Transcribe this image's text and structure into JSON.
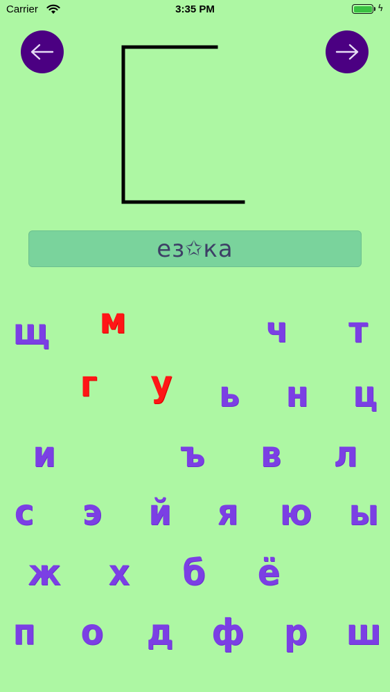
{
  "status_bar": {
    "carrier": "Carrier",
    "time": "3:35 PM"
  },
  "nav": {
    "back_icon": "arrow-left-icon",
    "forward_icon": "arrow-right-icon",
    "button_color": "#4b0082"
  },
  "word": {
    "prefix": "ез",
    "star": "✩",
    "suffix": "ка"
  },
  "colors": {
    "background": "#adf7a3",
    "letter": "#7b3fe4",
    "letter_selected": "#ff1616",
    "word_box": "#7ad39c"
  },
  "letters": [
    {
      "char": "щ",
      "selected": false
    },
    {
      "char": "м",
      "selected": true
    },
    {
      "char": "ч",
      "selected": false
    },
    {
      "char": "т",
      "selected": false
    },
    {
      "char": "г",
      "selected": true
    },
    {
      "char": "у",
      "selected": true
    },
    {
      "char": "ь",
      "selected": false
    },
    {
      "char": "н",
      "selected": false
    },
    {
      "char": "ц",
      "selected": false
    },
    {
      "char": "и",
      "selected": false
    },
    {
      "char": "ъ",
      "selected": false
    },
    {
      "char": "в",
      "selected": false
    },
    {
      "char": "л",
      "selected": false
    },
    {
      "char": "с",
      "selected": false
    },
    {
      "char": "э",
      "selected": false
    },
    {
      "char": "й",
      "selected": false
    },
    {
      "char": "я",
      "selected": false
    },
    {
      "char": "ю",
      "selected": false
    },
    {
      "char": "ы",
      "selected": false
    },
    {
      "char": "ж",
      "selected": false
    },
    {
      "char": "х",
      "selected": false
    },
    {
      "char": "б",
      "selected": false
    },
    {
      "char": "ё",
      "selected": false
    },
    {
      "char": "п",
      "selected": false
    },
    {
      "char": "о",
      "selected": false
    },
    {
      "char": "д",
      "selected": false
    },
    {
      "char": "ф",
      "selected": false
    },
    {
      "char": "р",
      "selected": false
    },
    {
      "char": "ш",
      "selected": false
    }
  ]
}
